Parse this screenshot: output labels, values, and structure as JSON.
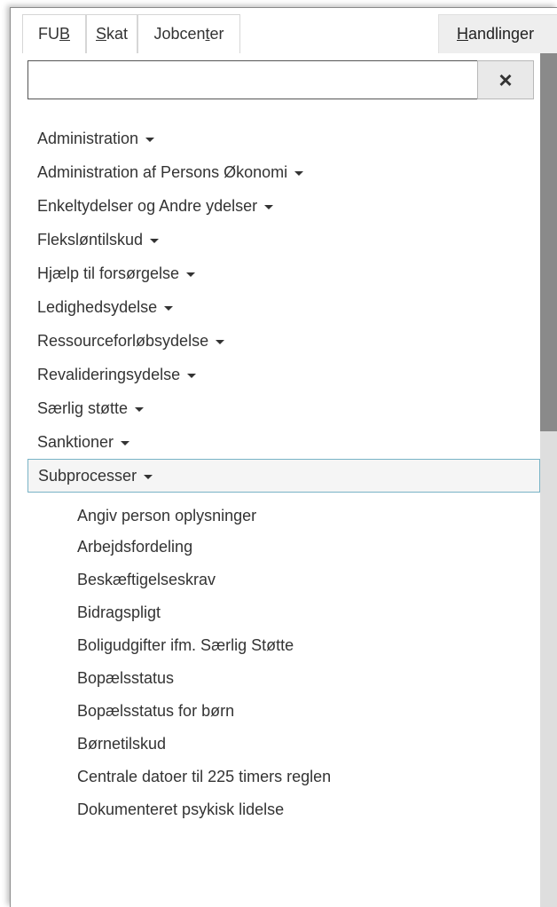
{
  "tabs": [
    {
      "pre": "FU",
      "key": "B",
      "post": ""
    },
    {
      "pre": "",
      "key": "S",
      "post": "kat"
    },
    {
      "pre": "Jobcen",
      "key": "t",
      "post": "er"
    }
  ],
  "actions_tab": {
    "pre": "",
    "key": "H",
    "post": "andlinger"
  },
  "search": {
    "value": "",
    "placeholder": ""
  },
  "clear_icon": "×",
  "menu": {
    "items": [
      "Administration",
      "Administration af Persons Økonomi",
      "Enkeltydelser og Andre ydelser",
      "Fleksløntilskud",
      "Hjælp til forsørgelse",
      "Ledighedsydelse",
      "Ressourceforløbsydelse",
      "Revalideringsydelse",
      "Særlig støtte",
      "Sanktioner"
    ],
    "active_item": "Subprocesser",
    "sub_items": [
      "Angiv person oplysninger",
      "Arbejdsfordeling",
      "Beskæftigelseskrav",
      "Bidragspligt",
      "Boligudgifter ifm. Særlig Støtte",
      "Bopælsstatus",
      "Bopælsstatus for børn",
      "Børnetilskud",
      "Centrale datoer til 225 timers reglen",
      "Dokumenteret psykisk lidelse"
    ]
  },
  "colors": {
    "text": "#333333",
    "active_border": "#79b3c6",
    "scroll_thumb": "#8a8a8a",
    "scroll_track": "#dedede"
  }
}
